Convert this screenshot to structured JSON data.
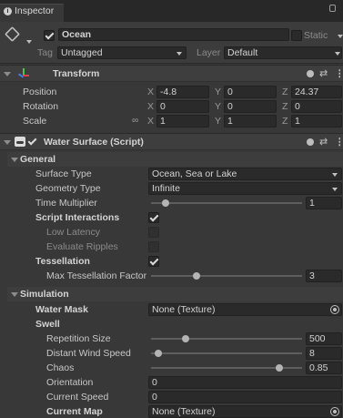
{
  "tab": {
    "title": "Inspector"
  },
  "gameobject": {
    "checked": true,
    "name": "Ocean",
    "static_label": "Static",
    "tag_label": "Tag",
    "tag_value": "Untagged",
    "layer_label": "Layer",
    "layer_value": "Default"
  },
  "transform": {
    "title": "Transform",
    "position": {
      "label": "Position",
      "x": "-4.8",
      "y": "0",
      "z": "24.37"
    },
    "rotation": {
      "label": "Rotation",
      "x": "0",
      "y": "0",
      "z": "0"
    },
    "scale": {
      "label": "Scale",
      "x": "1",
      "y": "1",
      "z": "1"
    },
    "axes": {
      "x": "X",
      "y": "Y",
      "z": "Z"
    }
  },
  "water": {
    "title": "Water Surface (Script)",
    "general": {
      "title": "General",
      "surface_type": {
        "label": "Surface Type",
        "value": "Ocean, Sea or Lake"
      },
      "geometry_type": {
        "label": "Geometry Type",
        "value": "Infinite"
      },
      "time_multiplier": {
        "label": "Time Multiplier",
        "value": "1",
        "fraction": 0.18
      },
      "script_interactions": {
        "label": "Script Interactions",
        "checked": true
      },
      "low_latency": {
        "label": "Low Latency",
        "checked": false
      },
      "evaluate_ripples": {
        "label": "Evaluate Ripples",
        "checked": false
      },
      "tessellation": {
        "label": "Tessellation",
        "checked": true
      },
      "max_tessellation": {
        "label": "Max Tessellation Factor",
        "value": "3",
        "fraction": 0.3
      }
    },
    "simulation": {
      "title": "Simulation",
      "water_mask": {
        "label": "Water Mask",
        "value": "None (Texture)"
      },
      "swell_label": "Swell",
      "repetition_size": {
        "label": "Repetition Size",
        "value": "500",
        "fraction": 0.25
      },
      "distant_wind_speed": {
        "label": "Distant Wind Speed",
        "value": "8",
        "fraction": 0.05
      },
      "chaos": {
        "label": "Chaos",
        "value": "0.85",
        "fraction": 0.85
      },
      "orientation": {
        "label": "Orientation",
        "value": "0"
      },
      "current_speed": {
        "label": "Current Speed",
        "value": "0"
      },
      "current_map": {
        "label": "Current Map",
        "value": "None (Texture)"
      }
    }
  }
}
